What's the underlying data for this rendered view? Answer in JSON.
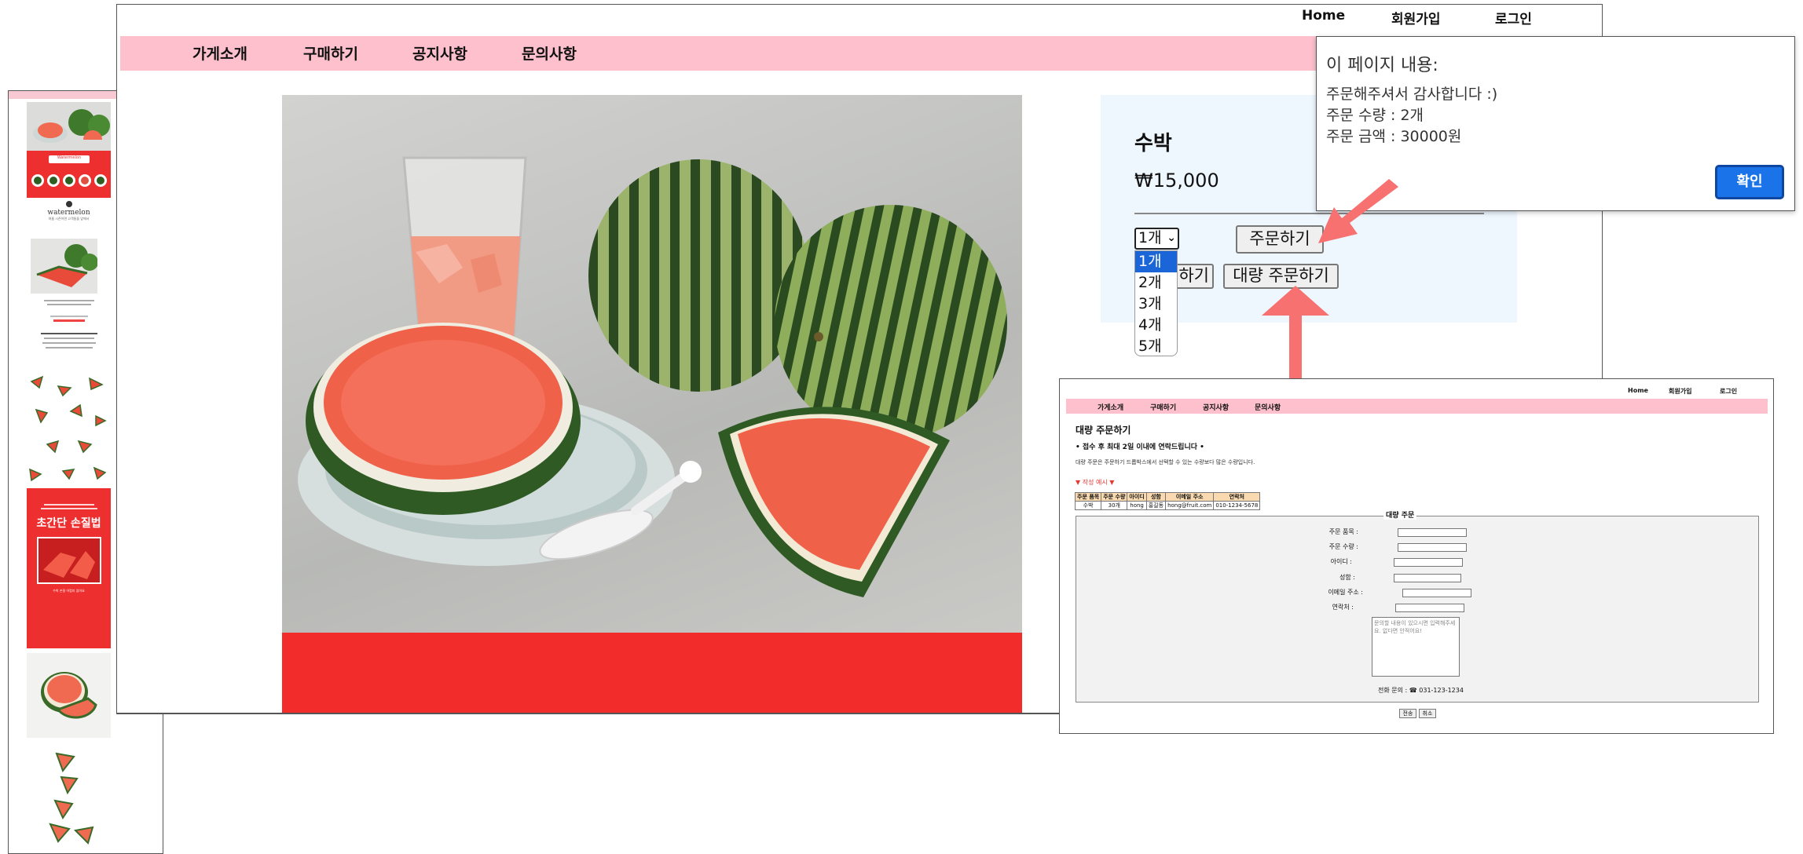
{
  "main_window": {
    "top_nav": [
      "Home",
      "회원가입",
      "로그인"
    ],
    "menu": [
      "가게소개",
      "구매하기",
      "공지사항",
      "문의사항"
    ],
    "product": {
      "name": "수박",
      "price": "₩15,000",
      "quantity_selected": "1개",
      "quantity_options": [
        "1개",
        "2개",
        "3개",
        "4개",
        "5개"
      ],
      "order_button": "주문하기",
      "cart_button_partial": "하기",
      "bulk_order_button": "대량 주문하기"
    }
  },
  "alert": {
    "title": "이 페이지 내용:",
    "lines": [
      "주문해주셔서 감사합니다 :)",
      "주문 수량 : 2개",
      "주문 금액 : 30000원"
    ],
    "ok_button": "확인"
  },
  "thumbnail": {
    "header_label": "Watermelon",
    "brand": "watermelon",
    "tagline": "여름 시즌이면 고객들을 앞에서",
    "banner_title": "초간단 손질법",
    "banner_subtitle": "수박 손질 어렵지 않아요"
  },
  "bulk_window": {
    "top_nav": [
      "Home",
      "회원가입",
      "로그인"
    ],
    "menu": [
      "가게소개",
      "구매하기",
      "공지사항",
      "문의사항"
    ],
    "title": "대량 주문하기",
    "subtitle": "• 접수 후 최대 2일 이내에 연락드립니다 •",
    "description": "대량 주문은 주문하기 드롭박스에서 선택할 수 있는 수량보다 많은 수량입니다.",
    "example_label": "▼ 작성 예시 ▼",
    "table": {
      "headers": [
        "주문 품목",
        "주문 수량",
        "아이디",
        "성함",
        "이메일 주소",
        "연락처"
      ],
      "row": [
        "수박",
        "30개",
        "hong",
        "홍길동",
        "hong@fruit.com",
        "010-1234-5678"
      ]
    },
    "form_legend": "대량 주문",
    "fields": [
      "주문 품목 :",
      "주문 수량 :",
      "아이디 :",
      "성함 :",
      "이메일 주소 :",
      "연락처 :"
    ],
    "textarea_placeholder": "문의할 내용이 있으시면 입력해주세요. 없다면 안적어요!",
    "phone_inquiry": "전화 문의 : ☎ 031-123-1234",
    "buttons": [
      "전송",
      "취소"
    ]
  },
  "colors": {
    "nav_pink": "#fdc0cc",
    "panel_blue": "#eef6fe",
    "accent_red": "#f22b2b",
    "arrow_salmon": "#f87171",
    "ok_blue": "#1a73e8"
  }
}
